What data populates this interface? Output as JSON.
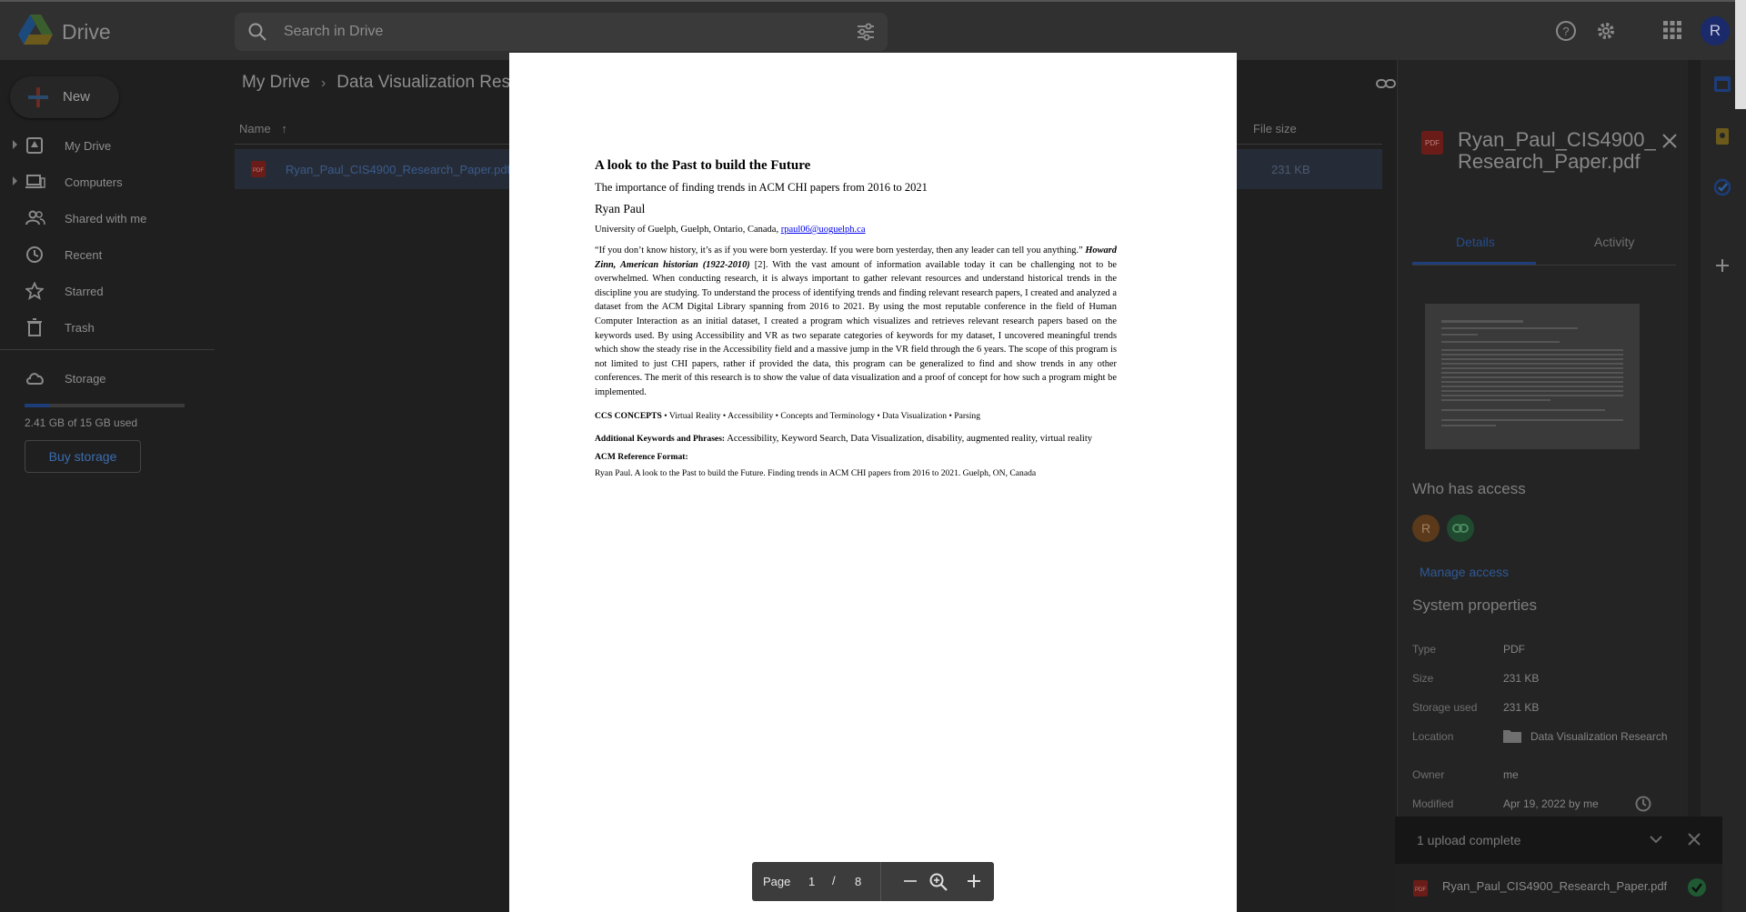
{
  "app": {
    "name": "Drive"
  },
  "search": {
    "placeholder": "Search in Drive"
  },
  "user": {
    "avatar_letter": "R"
  },
  "sidebar": {
    "new_label": "New",
    "items": [
      {
        "label": "My Drive",
        "icon": "my-drive-icon"
      },
      {
        "label": "Computers",
        "icon": "computers-icon"
      },
      {
        "label": "Shared with me",
        "icon": "shared-icon"
      },
      {
        "label": "Recent",
        "icon": "clock-icon"
      },
      {
        "label": "Starred",
        "icon": "star-icon"
      },
      {
        "label": "Trash",
        "icon": "trash-icon"
      }
    ],
    "storage_label": "Storage",
    "storage_used_text": "2.41 GB of 15 GB used",
    "storage_fraction": 0.16,
    "buy_storage": "Buy storage"
  },
  "breadcrumb": {
    "root": "My Drive",
    "current": "Data Visualization Rese"
  },
  "file_list": {
    "col_name": "Name",
    "col_size": "File size",
    "rows": [
      {
        "name": "Ryan_Paul_CIS4900_Research_Paper.pdf",
        "size": "231 KB"
      }
    ]
  },
  "details": {
    "title": "Ryan_Paul_CIS4900_Research_Paper.pdf",
    "tab_details": "Details",
    "tab_activity": "Activity",
    "who_has_access": "Who has access",
    "access_avatar": "R",
    "manage_access": "Manage access",
    "system_properties": "System properties",
    "props": [
      {
        "label": "Type",
        "value": "PDF"
      },
      {
        "label": "Size",
        "value": "231 KB"
      },
      {
        "label": "Storage used",
        "value": "231 KB"
      },
      {
        "label": "Location",
        "value": "Data Visualization Research"
      },
      {
        "label": "Owner",
        "value": "me"
      },
      {
        "label": "Modified",
        "value": "Apr 19, 2022 by me"
      }
    ]
  },
  "toast": {
    "title": "1 upload complete",
    "file": "Ryan_Paul_CIS4900_Research_Paper.pdf"
  },
  "paper": {
    "title": "A look to the Past to build the Future",
    "subtitle": "The importance of finding trends in ACM CHI papers from 2016 to 2021",
    "author": "Ryan Paul",
    "affiliation": "University of Guelph, Guelph, Ontario, Canada, ",
    "email": "rpaul06@uoguelph.ca",
    "quote": "“If you don’t know history, it’s as if you were born yesterday. If you were born yesterday, then any leader can tell you anything.” ",
    "quote_attrib": "Howard Zinn, American historian (1922-2010)",
    "abstract": " [2]. With the vast amount of information available today it can be challenging not to be overwhelmed. When conducting research, it is always important to gather relevant resources and understand historical trends in the discipline you are studying. To understand the process of identifying trends and finding relevant research papers, I created and analyzed a dataset from the ACM Digital Library spanning from 2016 to 2021. By using the most reputable conference in the field of Human Computer Interaction as an initial dataset, I created a program which visualizes and retrieves relevant research papers based on the keywords used. By using Accessibility and VR as two separate categories of keywords for my dataset, I uncovered meaningful trends which show the steady rise in the Accessibility field and a massive jump in the VR field through the 6 years. The scope of this program is not limited to just CHI papers, rather if provided the data, this program can be generalized to find and show trends in any other conferences. The merit of this research is to show the value of data visualization and a proof of concept for how such a program might be implemented.",
    "ccs_label": "CCS CONCEPTS",
    "ccs_text": " • Virtual Reality • Accessibility • Concepts and Terminology • Data Visualization • Parsing",
    "kw_label": "Additional Keywords and Phrases:",
    "kw_text": " Accessibility, Keyword Search, Data Visualization, disability, augmented reality, virtual reality",
    "ref_label": "ACM Reference Format:",
    "ref_text": "Ryan Paul. A look to the Past to build the Future. Finding trends in ACM CHI papers from 2016 to 2021. Guelph, ON, Canada"
  },
  "pdf_toolbar": {
    "page_label": "Page",
    "current": "1",
    "slash": "/",
    "total": "8"
  }
}
